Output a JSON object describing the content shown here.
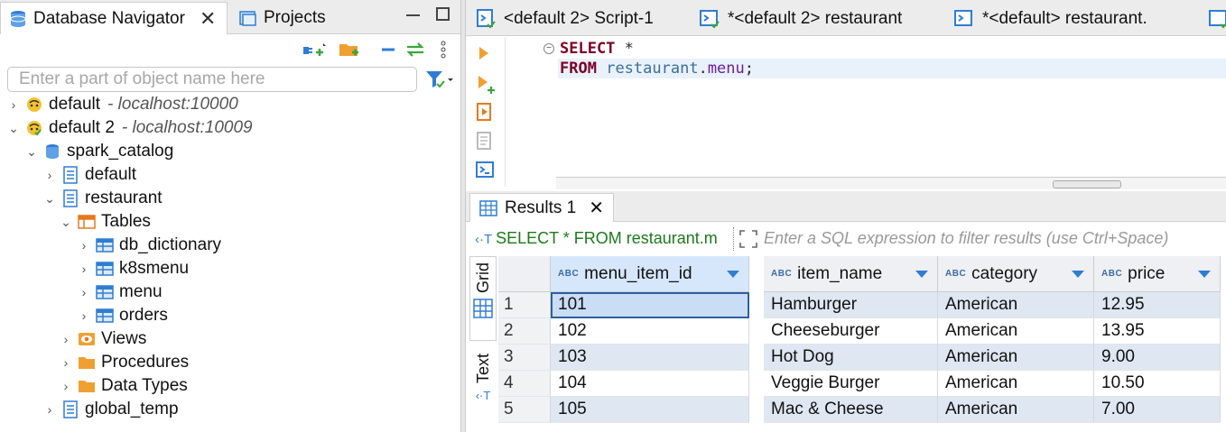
{
  "navigator": {
    "tab_label": "Database Navigator",
    "projects_tab_label": "Projects",
    "filter_placeholder": "Enter a part of object name here",
    "tree": {
      "conn1": {
        "name": "default",
        "host": "- localhost:10000"
      },
      "conn2": {
        "name": "default 2",
        "host": "- localhost:10009"
      },
      "catalog": "spark_catalog",
      "schema_default": "default",
      "schema_restaurant": "restaurant",
      "tables_folder": "Tables",
      "tables": [
        "db_dictionary",
        "k8smenu",
        "menu",
        "orders"
      ],
      "views": "Views",
      "procedures": "Procedures",
      "data_types": "Data Types",
      "global_temp": "global_temp"
    }
  },
  "editor": {
    "tabs": [
      "<default 2> Script-1",
      "*<default 2> restaurant",
      "*<default> restaurant."
    ],
    "code": {
      "line1_kw": "SELECT",
      "line1_rest": " *",
      "line2_kw": "FROM",
      "line2_schema": "restaurant",
      "line2_dot": ".",
      "line2_table": "menu",
      "line2_semi": ";"
    }
  },
  "results": {
    "tab_label": "Results 1",
    "query_text": "SELECT * FROM restaurant.m",
    "filter_placeholder": "Enter a SQL expression to filter results (use Ctrl+Space)",
    "side_tabs": {
      "grid": "Grid",
      "text": "Text"
    },
    "type_badge": "ABC",
    "columns": [
      "menu_item_id",
      "item_name",
      "category",
      "price"
    ],
    "rows": [
      {
        "n": "1",
        "cells": [
          "101",
          "Hamburger",
          "American",
          "12.95"
        ]
      },
      {
        "n": "2",
        "cells": [
          "102",
          "Cheeseburger",
          "American",
          "13.95"
        ]
      },
      {
        "n": "3",
        "cells": [
          "103",
          "Hot Dog",
          "American",
          "9.00"
        ]
      },
      {
        "n": "4",
        "cells": [
          "104",
          "Veggie Burger",
          "American",
          "10.50"
        ]
      },
      {
        "n": "5",
        "cells": [
          "105",
          "Mac & Cheese",
          "American",
          "7.00"
        ]
      }
    ]
  },
  "colors": {
    "keyword": "#7a0026",
    "identifier": "#3a6f99",
    "query": "#1c7a1c",
    "accent": "#2f7dd3"
  }
}
